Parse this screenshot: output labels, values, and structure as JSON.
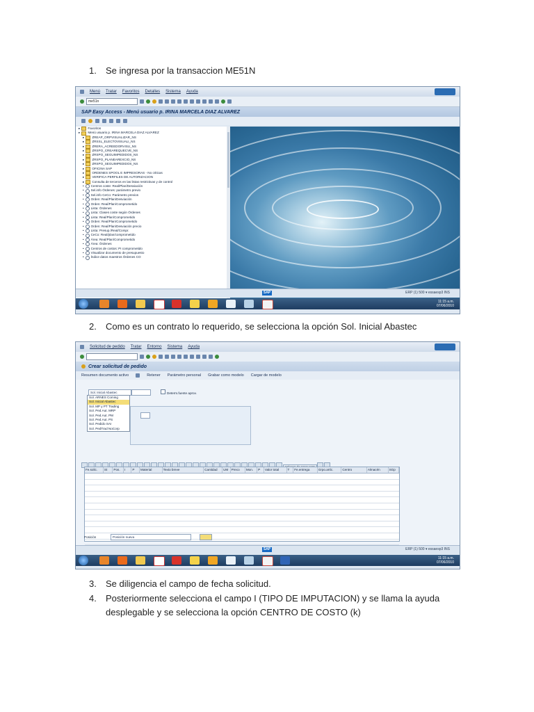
{
  "steps": [
    {
      "num": "1.",
      "text": "Se ingresa por la transaccion ME51N"
    },
    {
      "num": "2.",
      "text": "Como es un contrato lo requerido, se selecciona la opción Sol. Inicial Abastec"
    },
    {
      "num": "3.",
      "text": "Se diligencia el campo de fecha solicitud."
    },
    {
      "num": "4.",
      "text": "Posteriormente selecciona el campo I (TIPO DE IMPUTACION) y se llama la ayuda"
    },
    {
      "num": "",
      "text": "desplegable y se selecciona la opción CENTRO DE COSTO (k)"
    }
  ],
  "shot1": {
    "menu": [
      "Menú",
      "Tratar",
      "Favoritos",
      "Detalles",
      "Sistema",
      "Ayuda"
    ],
    "command": "me51n",
    "title": "SAP Easy Access  -  Menú usuario p. IRINA MARCELA DIAZ ALVAREZ",
    "tree": [
      {
        "icon": "folder",
        "indent": 0,
        "label": "Favoritos"
      },
      {
        "icon": "folder",
        "indent": 0,
        "label": "Menú usuario p. IRINA MARCELA DIAZ ALVAREZ"
      },
      {
        "icon": "folder",
        "indent": 1,
        "label": "ZREAP_ORPVISUALIZAR_NS"
      },
      {
        "icon": "folder",
        "indent": 1,
        "label": "ZRSSL_ELECTOVISUALI_NS"
      },
      {
        "icon": "folder",
        "indent": 1,
        "label": "ZRERA_ACREEDORVISU_NS"
      },
      {
        "icon": "folder",
        "indent": 1,
        "label": "ZRSPO_CREAREQUECVE_NS"
      },
      {
        "icon": "folder",
        "indent": 1,
        "label": "ZRSPO_SEGUIMPEDIDOS_NS"
      },
      {
        "icon": "folder",
        "indent": 1,
        "label": "ZRSPO_PLANEAREXCIO_NS"
      },
      {
        "icon": "folder",
        "indent": 1,
        "label": "ZRSPO_SEGUIMPEDIDOS_NS"
      },
      {
        "icon": "folder",
        "indent": 1,
        "label": "OFICINA SAP"
      },
      {
        "icon": "folder",
        "indent": 1,
        "label": "ORDENES SPOOL E IMPRESORAS - No criticas"
      },
      {
        "icon": "folder",
        "indent": 1,
        "label": "VERIFICA PERFILES DE AUTORIZACION"
      },
      {
        "icon": "folder",
        "indent": 1,
        "label": "Consulta de terceros en las listas restrictivas y de control"
      },
      {
        "icon": "chain",
        "indent": 1,
        "label": "Centros coste: Real/Plan/Desviación"
      },
      {
        "icon": "chain",
        "indent": 1,
        "label": "Sel.info Órdenes: parámetro previo"
      },
      {
        "icon": "chain",
        "indent": 1,
        "label": "Sel.info CeCo: Parámetro previos"
      },
      {
        "icon": "chain",
        "indent": 1,
        "label": "Orden: Real/Plan/Desviación"
      },
      {
        "icon": "chain",
        "indent": 1,
        "label": "Orden: Real/Plan/Comprometido"
      },
      {
        "icon": "chain",
        "indent": 1,
        "label": "Lista: Órdenes"
      },
      {
        "icon": "chain",
        "indent": 1,
        "label": "Lista: Clases coste según Órdenes"
      },
      {
        "icon": "chain",
        "indent": 1,
        "label": "Lista: Real/Plan/Comprometido"
      },
      {
        "icon": "chain",
        "indent": 1,
        "label": "Orden: Real/Plan/Comprometido"
      },
      {
        "icon": "chain",
        "indent": 1,
        "label": "Orden: Real/Plan/Desviación precio"
      },
      {
        "icon": "chain",
        "indent": 1,
        "label": "Lista: Presup./Real/Compr."
      },
      {
        "icon": "chain",
        "indent": 1,
        "label": "CeCo: Real/plan/comprometido"
      },
      {
        "icon": "chain",
        "indent": 1,
        "label": "Área: Real/Plan/Comprometido"
      },
      {
        "icon": "chain",
        "indent": 1,
        "label": "Área: Órdenes"
      },
      {
        "icon": "chain",
        "indent": 1,
        "label": "Centros de costos: PI comprometido"
      },
      {
        "icon": "chain",
        "indent": 1,
        "label": "Visualizar documento de presupuesto"
      },
      {
        "icon": "chain",
        "indent": 1,
        "label": "Índice datos maestros Órdenes CO"
      }
    ],
    "status": "ERP (1) 500  ▾  essaesp3  INS"
  },
  "shot2": {
    "menu": [
      "Solicitud de pedido",
      "Tratar",
      "Entorno",
      "Sistema",
      "Ayuda"
    ],
    "title": "Crear solicitud de pedido",
    "toolbar": [
      "Resumen documento activo",
      "Retener",
      "Parámetro personal",
      "Grabar como modelo",
      "Cargar de modelo"
    ],
    "doc_type": "Sol. Inicial Abastec",
    "dropdown": [
      "Sol. ARNES Coming",
      "Sol. Inicial Abastec",
      "Sol. MP y PT Trading",
      "Sol. Ped.Aut. MRP",
      "Sol. Ped.Aut. PM",
      "Sol. Ped.Aut. PS",
      "Sol. Pedido SAI",
      "Sol. PedTrad NoCorp"
    ],
    "selected_index": 1,
    "checkbox_label": "Determ.fuente aprov.",
    "proposal_button": "Valores de propuesta",
    "columns": [
      "St",
      "Pos.",
      "I",
      "P",
      "Material",
      "Texto breve",
      "Cantidad",
      "UM",
      "Preco",
      "Mon.",
      "P",
      "Valor total",
      "T",
      "Fe.entrega",
      "Grpo.artíc.",
      "Centro",
      "Almacén",
      "SGp"
    ],
    "first_column": "Fe.solic.",
    "position_label": "Posición",
    "position_value": "Posición nueva",
    "status": "ERP (1) 500  ▾  essaesp3  INS"
  },
  "taskbar": {
    "clock_time": "11:15 a.m.",
    "clock_date": "07/06/2010",
    "clock2_time": "11:15 a.m.",
    "clock2_date": "07/06/2010"
  }
}
